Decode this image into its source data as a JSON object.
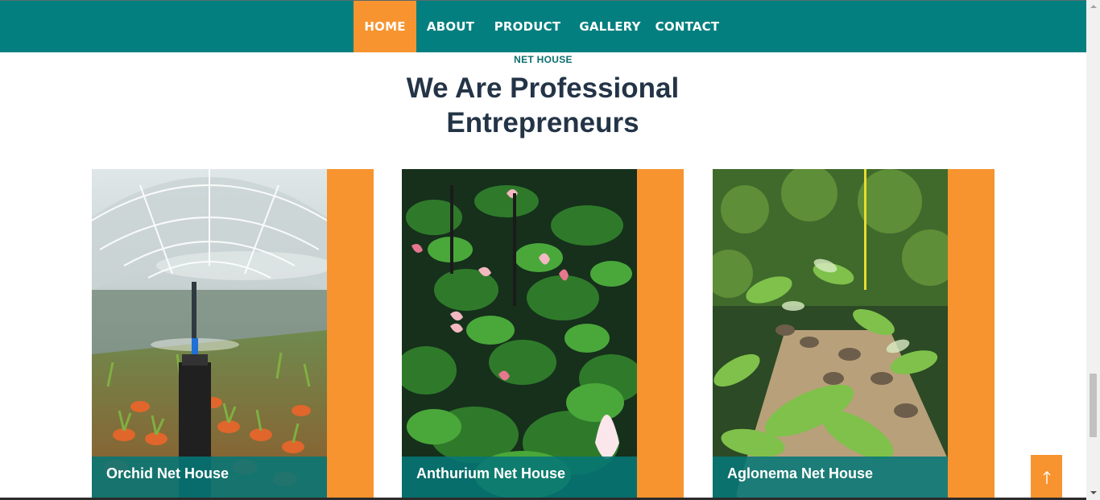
{
  "nav": {
    "items": [
      {
        "label": "HOME",
        "active": true
      },
      {
        "label": "ABOUT",
        "active": false
      },
      {
        "label": "PRODUCT",
        "active": false
      },
      {
        "label": "GALLERY",
        "active": false
      },
      {
        "label": "CONTACT",
        "active": false
      }
    ]
  },
  "section": {
    "eyebrow": "NET HOUSE",
    "title_line1": "We Are Professional",
    "title_line2": "Entrepreneurs"
  },
  "cards": [
    {
      "title": "Orchid Net House"
    },
    {
      "title": "Anthurium Net House"
    },
    {
      "title": "Aglonema Net House"
    }
  ],
  "colors": {
    "primary_teal": "#037f7f",
    "accent_orange": "#f7942f",
    "heading_navy": "#243447"
  },
  "icons": {
    "back_to_top": "arrow-up-icon"
  }
}
